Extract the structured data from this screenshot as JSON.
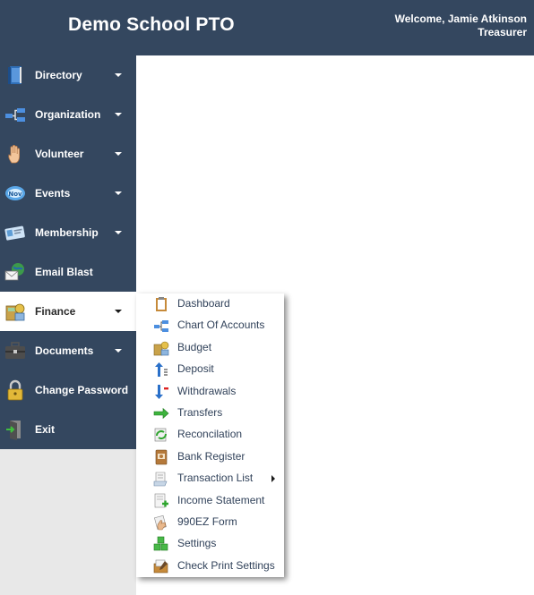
{
  "header": {
    "title": "Demo School PTO",
    "welcome_line1": "Welcome, Jamie Atkinson",
    "welcome_line2": "Treasurer"
  },
  "menu": [
    {
      "label": "Directory",
      "icon": "book-icon",
      "has_caret": true
    },
    {
      "label": "Organization",
      "icon": "org-chart-icon",
      "has_caret": true
    },
    {
      "label": "Volunteer",
      "icon": "raised-hand-icon",
      "has_caret": true
    },
    {
      "label": "Events",
      "icon": "events-icon",
      "has_caret": true
    },
    {
      "label": "Membership",
      "icon": "membership-card-icon",
      "has_caret": true
    },
    {
      "label": "Email Blast",
      "icon": "email-globe-icon",
      "has_caret": false
    },
    {
      "label": "Finance",
      "icon": "finance-icon",
      "has_caret": true,
      "active": true
    },
    {
      "label": "Documents",
      "icon": "briefcase-icon",
      "has_caret": true
    },
    {
      "label": "Change Password",
      "icon": "padlock-icon",
      "has_caret": false
    },
    {
      "label": "Exit",
      "icon": "exit-door-icon",
      "has_caret": false
    }
  ],
  "finance_submenu": [
    {
      "label": "Dashboard",
      "icon": "clipboard-icon"
    },
    {
      "label": "Chart Of Accounts",
      "icon": "chart-of-accounts-icon"
    },
    {
      "label": "Budget",
      "icon": "budget-icon"
    },
    {
      "label": "Deposit",
      "icon": "deposit-icon"
    },
    {
      "label": "Withdrawals",
      "icon": "withdrawals-icon"
    },
    {
      "label": "Transfers",
      "icon": "transfers-arrow-icon"
    },
    {
      "label": "Reconcilation",
      "icon": "reconcile-icon"
    },
    {
      "label": "Bank Register",
      "icon": "bank-register-icon"
    },
    {
      "label": "Transaction List",
      "icon": "transaction-list-icon",
      "has_submenu": true
    },
    {
      "label": "Income Statement",
      "icon": "income-statement-icon"
    },
    {
      "label": "990EZ Form",
      "icon": "form-hand-icon"
    },
    {
      "label": "Settings",
      "icon": "settings-cubes-icon"
    },
    {
      "label": "Check Print Settings",
      "icon": "check-print-icon"
    }
  ],
  "colors": {
    "header_bg": "#34475f",
    "sidebar_bg": "#34475f",
    "sidebar_empty_bg": "#e8e8e8",
    "submenu_text": "#31425a"
  }
}
